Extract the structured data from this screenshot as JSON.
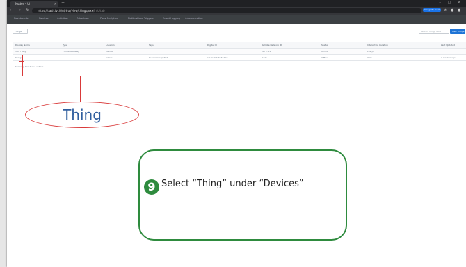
{
  "browser": {
    "tab_title": "Nodes – Ui",
    "tab_close": "×",
    "new_tab": "+",
    "window_controls": "– □ ×",
    "nav_buttons": "← → ↻ ⌂",
    "url": "https://dash.ivi.it/ui/#ui/view/things/xxx",
    "url_tail": "/info/tab",
    "ext_button": "Incognito mode / user",
    "ext_icons": "★ ● ● ⋮"
  },
  "menubar": {
    "items": [
      "Dashboards",
      "Devices",
      "Activities",
      "Schedules",
      "Data Analytics",
      "Notifications Triggers",
      "Event Logging",
      "Administration"
    ]
  },
  "toolbar": {
    "entity_button": "Things",
    "search_placeholder": "Search Things here",
    "new_button": "New Things"
  },
  "grid": {
    "headers": [
      "Display Name",
      "Type",
      "Location",
      "Tags",
      "Digital ID",
      "Remote Network ID",
      "Status",
      "Interaction Location",
      "Last Updated"
    ],
    "rows": [
      [
        "Test Thing",
        "TNode Gateway",
        "Manila",
        "",
        "",
        "1PT7H11",
        "Offline",
        "Philly1",
        ""
      ],
      [
        "Thing2",
        "",
        "Admin",
        "Sensor Group Test",
        "1d:2c3f:4a5b6e7f-0",
        "Node",
        "Offline",
        "Yello",
        "3 months ago"
      ]
    ],
    "paging": "Showing 1 to 2 of 2 entries"
  },
  "callouts": {
    "thing_label": "Thing",
    "step_number": "9",
    "instruction": "Select “Thing” under “Devices”"
  },
  "colors": {
    "callout_red": "#d93a3a",
    "instruction_green": "#2e8b3e",
    "thing_text_blue": "#2f5e9e",
    "primary_button": "#1f74d6"
  }
}
